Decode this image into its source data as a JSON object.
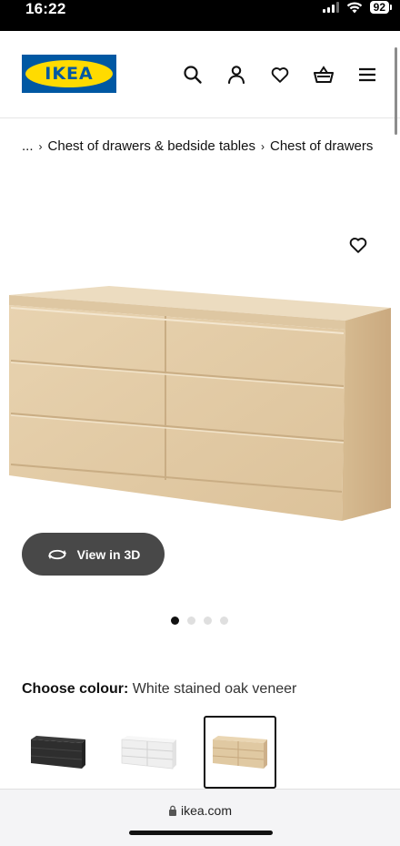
{
  "status": {
    "time": "16:22",
    "battery": "92"
  },
  "brand": {
    "logo_text": "IKEA",
    "blue": "#0058a3",
    "yellow": "#ffdb00"
  },
  "header": {
    "icons": [
      "search-icon",
      "user-icon",
      "heart-icon",
      "basket-icon",
      "menu-icon"
    ]
  },
  "breadcrumb": {
    "ellipsis": "...",
    "items": [
      "Chest of drawers & bedside tables",
      "Chest of drawers"
    ]
  },
  "product": {
    "view3d_label": "View in 3D",
    "image_count": 4,
    "active_image": 1
  },
  "colour": {
    "label": "Choose colour:",
    "value": "White stained oak veneer",
    "options": [
      "black-brown",
      "white",
      "white stained oak veneer"
    ],
    "selected_index": 2
  },
  "browser": {
    "url": "ikea.com"
  }
}
